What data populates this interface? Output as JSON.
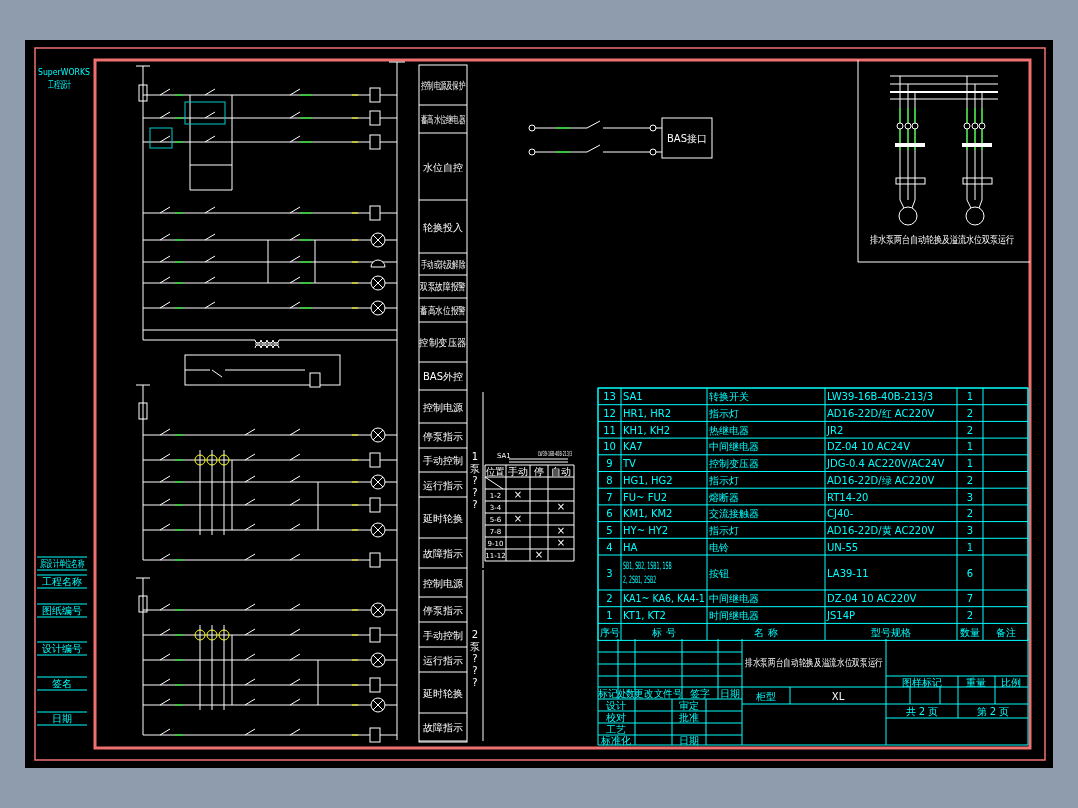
{
  "sidebar": {
    "logo": "SuperWORKS",
    "subtitle": "工程设计",
    "fields": [
      "原设计单位名称",
      "工程名称",
      "图纸编号",
      "设计编号",
      "签名",
      "日期"
    ]
  },
  "section_labels": [
    {
      "label": "控制电源及保护"
    },
    {
      "label": "蓄高水位继电器"
    },
    {
      "label": "水位自控"
    },
    {
      "label": "轮换投入"
    },
    {
      "label": "手动或转及解除"
    },
    {
      "label": "双泵故障报警"
    },
    {
      "label": "蓄高水位报警"
    },
    {
      "label": "控制变压器"
    },
    {
      "label": "BAS外控"
    }
  ],
  "pump_groups": [
    {
      "side_label": "1泵???",
      "labels": [
        "控制电源",
        "停泵指示",
        "手动控制",
        "运行指示",
        "延时轮换",
        "故障指示"
      ]
    },
    {
      "side_label": "2泵???",
      "labels": [
        "控制电源",
        "停泵指示",
        "手动控制",
        "运行指示",
        "延时轮换",
        "故障指示"
      ]
    }
  ],
  "bas_box": "BAS接口",
  "switch_table": {
    "title": "SA1",
    "model": "LW39-16B-40B-213/3",
    "columns": [
      "位置",
      "手动",
      "停",
      "自动"
    ],
    "rows": [
      [
        "1-2",
        "×",
        "",
        ""
      ],
      [
        "3-4",
        "",
        "",
        "×"
      ],
      [
        "5-6",
        "×",
        "",
        ""
      ],
      [
        "7-8",
        "",
        "",
        "×"
      ],
      [
        "9-10",
        "",
        "",
        "×"
      ],
      [
        "11-12",
        "",
        "×",
        ""
      ]
    ]
  },
  "motor_diagram": {
    "caption": "排水泵两台自动轮换及溢流水位双泵运行"
  },
  "parts_table": {
    "rows": [
      [
        "13",
        "SA1",
        "转换开关",
        "LW39-16B-40B-213/3",
        "1",
        ""
      ],
      [
        "12",
        "HR1, HR2",
        "指示灯",
        "AD16-22D/红 AC220V",
        "2",
        ""
      ],
      [
        "11",
        "KH1, KH2",
        "热继电器",
        "JR2",
        "2",
        ""
      ],
      [
        "10",
        "KA7",
        "中间继电器",
        "DZ-04 10 AC24V",
        "1",
        ""
      ],
      [
        "9",
        "TV",
        "控制变压器",
        "JDG-0.4 AC220V/AC24V",
        "1",
        ""
      ],
      [
        "8",
        "HG1, HG2",
        "指示灯",
        "AD16-22D/绿 AC220V",
        "2",
        ""
      ],
      [
        "7",
        "FU~ FU2",
        "熔断器",
        "RT14-20",
        "3",
        ""
      ],
      [
        "6",
        "KM1, KM2",
        "交流接触器",
        "CJ40-",
        "2",
        ""
      ],
      [
        "5",
        "HY~ HY2",
        "指示灯",
        "AD16-22D/黄 AC220V",
        "3",
        ""
      ],
      [
        "4",
        "HA",
        "电铃",
        "UN-55",
        "1",
        ""
      ],
      [
        "3",
        "SB1, SB2, 1SB1, 1SB2, 2SB1, 2SB2",
        "按钮",
        "LA39-11",
        "6",
        ""
      ],
      [
        "2",
        "KA1~ KA6, KA4-1",
        "中间继电器",
        "DZ-04 10 AC220V",
        "7",
        ""
      ],
      [
        "1",
        "KT1, KT2",
        "时间继电器",
        "JS14P",
        "2",
        ""
      ]
    ],
    "header_row": [
      "序号",
      "标  号",
      "名  称",
      "型号规格",
      "数量",
      "备注"
    ]
  },
  "title_block": {
    "title": "排水泵两台自动轮换及溢流水位双泵运行",
    "revision_headers": [
      "标记",
      "处数",
      "更改文件号",
      "签字",
      "日期"
    ],
    "signoff": [
      "设计",
      "审定",
      "校对",
      "批准",
      "工艺",
      "标准化",
      "日期"
    ],
    "cabinet_label": "柜型",
    "cabinet_value": "XL",
    "mark_headers": [
      "图样标记",
      "重量",
      "比例"
    ],
    "sheets_total": "共 2 页",
    "sheet_number": "第 2 页"
  }
}
